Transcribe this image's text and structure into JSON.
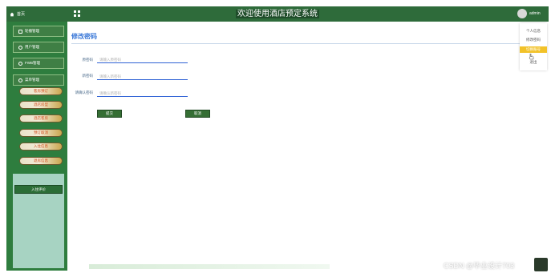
{
  "header": {
    "home_label": "首页",
    "title": "欢迎使用酒店预定系统",
    "username": "admin"
  },
  "sidebar": {
    "items": [
      {
        "label": "轮播管理"
      },
      {
        "label": "用户管理"
      },
      {
        "label": "FWB管理"
      },
      {
        "label": "菜单管理"
      }
    ],
    "subitems": [
      {
        "label": "客房预订"
      },
      {
        "label": "酒店房型"
      },
      {
        "label": "酒店客房"
      },
      {
        "label": "预订取消"
      },
      {
        "label": "入住信息"
      },
      {
        "label": "退房信息"
      }
    ],
    "active_subitem": "入住评价"
  },
  "main": {
    "page_title": "修改密码",
    "form": {
      "old_password_label": "原密码",
      "old_password_placeholder": "请输入原密码",
      "new_password_label": "新密码",
      "new_password_placeholder": "请输入新密码",
      "confirm_password_label": "请确认密码",
      "confirm_password_placeholder": "请确认新密码"
    },
    "submit_label": "提交",
    "cancel_label": "取消"
  },
  "dropdown": {
    "items": [
      {
        "label": "个人信息"
      },
      {
        "label": "修改密码"
      },
      {
        "label": "切换账号"
      },
      {
        "label": "退出"
      }
    ],
    "active_index": 2
  },
  "watermark": "CSDN @毕业设计703",
  "colors": {
    "header_bg": "#2e6b3a",
    "sidebar_bg": "#2e7d3e",
    "title_blue": "#3a78d8",
    "dropdown_active": "#f2c229"
  }
}
